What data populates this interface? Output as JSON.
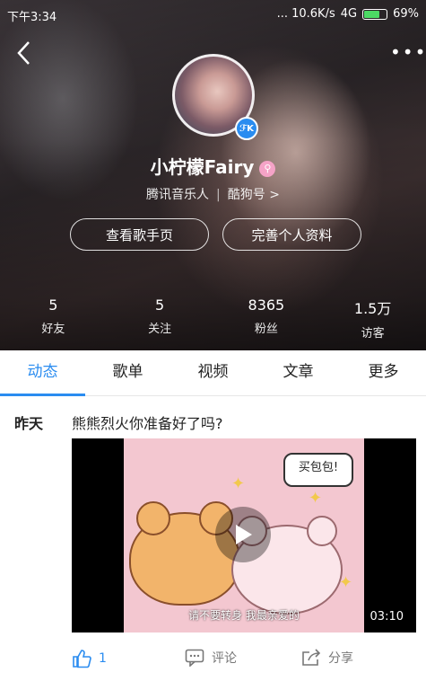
{
  "status_bar": {
    "time": "下午3:34",
    "network": "... 10.6K/s",
    "signal": "4G",
    "battery_pct": "69%"
  },
  "profile": {
    "name": "小柠檬Fairy",
    "role": "腾讯音乐人",
    "kugou": "酷狗号",
    "chevron": ">",
    "badge": "ℱK"
  },
  "buttons": {
    "singer_page": "查看歌手页",
    "edit_profile": "完善个人资料"
  },
  "stats": [
    {
      "value": "5",
      "label": "好友"
    },
    {
      "value": "5",
      "label": "关注"
    },
    {
      "value": "8365",
      "label": "粉丝"
    },
    {
      "value": "1.5万",
      "label": "访客"
    }
  ],
  "tabs": [
    {
      "label": "动态"
    },
    {
      "label": "歌单"
    },
    {
      "label": "视频"
    },
    {
      "label": "文章"
    },
    {
      "label": "更多"
    }
  ],
  "post": {
    "date": "昨天",
    "text": "熊熊烈火你准备好了吗?",
    "speech": "买包包!",
    "subtitle": "请不要转身 我最亲爱的",
    "duration": "03:10",
    "likes": "1",
    "comment_label": "评论",
    "share_label": "分享"
  }
}
